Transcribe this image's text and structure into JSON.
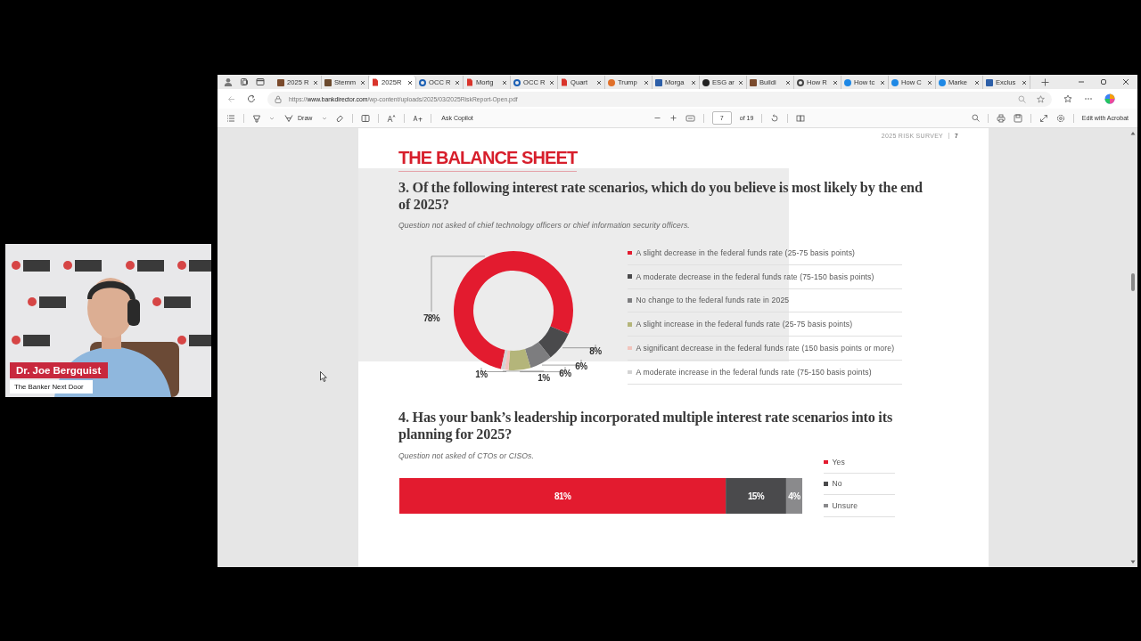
{
  "browser": {
    "tabs": [
      {
        "title": "2025 R",
        "kind": "square",
        "color": "#7a4a2c",
        "selected": false
      },
      {
        "title": "Stemm",
        "kind": "square",
        "color": "#6b4a2e",
        "selected": false
      },
      {
        "title": "2025R",
        "kind": "pdf",
        "color": "#d9342b",
        "selected": true
      },
      {
        "title": "OCC R",
        "kind": "ring",
        "color": "#1a5fb4",
        "selected": false
      },
      {
        "title": "Mortg",
        "kind": "pdf",
        "color": "#d9342b",
        "selected": false
      },
      {
        "title": "OCC R",
        "kind": "ring",
        "color": "#1a5fb4",
        "selected": false
      },
      {
        "title": "Quart",
        "kind": "pdf",
        "color": "#d9342b",
        "selected": false
      },
      {
        "title": "Trump",
        "kind": "disc",
        "color": "#e0702a",
        "selected": false
      },
      {
        "title": "Morga",
        "kind": "square",
        "color": "#2d5fa8",
        "selected": false
      },
      {
        "title": "ESG ar",
        "kind": "disc",
        "color": "#222222",
        "selected": false
      },
      {
        "title": "Buildi",
        "kind": "square",
        "color": "#7a4a2c",
        "selected": false
      },
      {
        "title": "How R",
        "kind": "ring",
        "color": "#444444",
        "selected": false
      },
      {
        "title": "How tc",
        "kind": "disc",
        "color": "#1e88e5",
        "selected": false
      },
      {
        "title": "How C",
        "kind": "disc",
        "color": "#1e88e5",
        "selected": false
      },
      {
        "title": "Marke",
        "kind": "disc",
        "color": "#1e88e5",
        "selected": false
      },
      {
        "title": "Exclus",
        "kind": "square",
        "color": "#2d5fa8",
        "selected": false
      }
    ],
    "url": "https://**www.bankdirector.com**/wp-content/uploads/2025/03/2025RiskReport-Open.pdf"
  },
  "pdf_toolbar": {
    "draw_label": "Draw",
    "copilot_label": "Ask Copilot",
    "page_number": "7",
    "page_total": "of 19",
    "edit_label": "Edit with Acrobat"
  },
  "page": {
    "running_header": "2025 RISK SURVEY",
    "page_number": "7",
    "section_title": "THE BALANCE SHEET",
    "questions": [
      {
        "text": "3.  Of the following interest rate scenarios, which do you believe is most likely by the end of 2025?",
        "note": "Question not asked of chief technology officers or chief information security officers.",
        "chart_data": {
          "type": "donut",
          "categories": [
            "A slight decrease in the federal funds rate (25-75 basis points)",
            "A moderate decrease in the federal funds rate (75-150 basis points)",
            "No change to the federal funds rate in 2025",
            "A slight increase in the federal funds rate (25-75 basis points)",
            "A significant decrease in the federal funds rate (150 basis points or more)",
            "A moderate increase in the federal funds rate (75-150 basis points)"
          ],
          "values": [
            78,
            8,
            6,
            6,
            1,
            1
          ],
          "colors": [
            "#e31b2f",
            "#4a4a4c",
            "#7d7d7f",
            "#b4b57a",
            "#f2c4bd",
            "#d3d3d3"
          ],
          "value_labels": [
            "78%",
            "8%",
            "6%",
            "6%",
            "1%",
            "1%"
          ]
        }
      },
      {
        "text": "4.  Has your bank’s leadership incorporated multiple interest rate scenarios into its planning for 2025?",
        "note": "Question not asked of CTOs or CISOs.",
        "chart_data": {
          "type": "bar",
          "orientation": "horizontal",
          "stacked": true,
          "series": [
            {
              "name": "Yes",
              "color": "#e31b2f",
              "values": [
                81
              ],
              "value_labels": [
                "81%"
              ]
            },
            {
              "name": "No",
              "color": "#4a4a4c",
              "values": [
                15
              ],
              "value_labels": [
                "15%"
              ]
            },
            {
              "name": "Unsure",
              "color": "#8a8a8c",
              "values": [
                4
              ],
              "value_labels": [
                "4%"
              ]
            }
          ]
        }
      }
    ]
  },
  "webcam": {
    "name": "Dr. Joe Bergquist",
    "show": "The Banker Next Door"
  }
}
